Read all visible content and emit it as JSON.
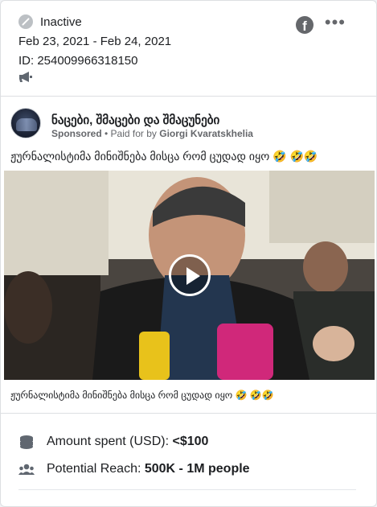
{
  "status": {
    "label": "Inactive",
    "icon": "inactive-icon"
  },
  "dates": "Feb 23, 2021 - Feb 24, 2021",
  "library_id": "ID: 254009966318150",
  "platform_icons": [
    "facebook-icon"
  ],
  "more_icon": "more-options-icon",
  "ad": {
    "page_name": "ნაცები, შმაცები და შმაცუნები",
    "sponsored": "Sponsored",
    "paid_for_prefix": " • Paid for by ",
    "paid_for_by": "Giorgi Kvaratskhelia",
    "body_text": "ჟურნალისტიმა მინიშნება მისცა რომ ცუდად იყო 🤣 🤣🤣",
    "caption": "ჟურნალისტიმა მინიშნება მისცა რომ ცუდად იყო 🤣 🤣🤣",
    "video_icon": "play-icon"
  },
  "stats": {
    "amount_label": "Amount spent (USD): ",
    "amount_value": "<$100",
    "reach_label": "Potential Reach: ",
    "reach_value": "500K - 1M people"
  },
  "colors": {
    "secondary_text": "#65676b",
    "border": "#dddfe2",
    "text": "#1c1e21"
  }
}
